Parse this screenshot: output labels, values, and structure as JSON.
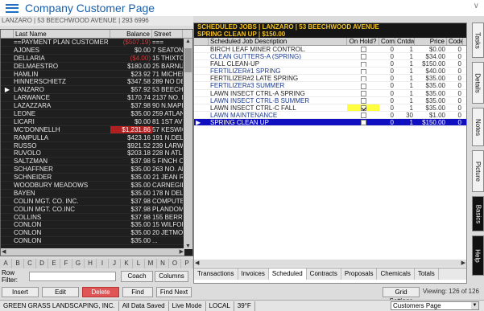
{
  "app": {
    "title": "Company Customer Page",
    "subtitle": "LANZARO | 53 BEECHWOOD AVENUE | 293 6996"
  },
  "customers": {
    "headers": [
      "Last Name",
      "Balance",
      "Street"
    ],
    "rows": [
      {
        "name": "==PAYMENT PLAN CUSTOMER",
        "balance": "($507.19)",
        "street": "===",
        "neg": true
      },
      {
        "name": "AJONES",
        "balance": "$0.00",
        "street": "7 SEATON"
      },
      {
        "name": "DELLARIA",
        "balance": "($4.00)",
        "street": "15 THIXTO",
        "neg": true
      },
      {
        "name": "DELMAESTRO",
        "balance": "$180.00",
        "street": "25 BARNUI"
      },
      {
        "name": "HAMLIN",
        "balance": "$23.92",
        "street": "71 MICHEL"
      },
      {
        "name": "HINNERSCHIETZ",
        "balance": "$347.58",
        "street": "289 NO DE"
      },
      {
        "name": "LANZARO",
        "balance": "$57.92",
        "street": "53 BEECH",
        "current": true
      },
      {
        "name": "LARWANCE",
        "balance": "$170.74",
        "street": "2137 NO. D"
      },
      {
        "name": "LAZAZZARA",
        "balance": "$37.98",
        "street": "90 N.MAPL"
      },
      {
        "name": "LEONE",
        "balance": "$35.00",
        "street": "259 ATLAN"
      },
      {
        "name": "LICARI",
        "balance": "$0.00",
        "street": "81 1ST AVE"
      },
      {
        "name": "MC'DONNELLH",
        "balance": "$1,231.86",
        "street": "57 KESWIC",
        "red": true
      },
      {
        "name": "RAMPULLA",
        "balance": "$423.16",
        "street": "191 N.DEL"
      },
      {
        "name": "RUSSO",
        "balance": "$921.52",
        "street": "239 LARW"
      },
      {
        "name": "RUVOLO",
        "balance": "$203.18",
        "street": "228 N ATL"
      },
      {
        "name": "SALTZMAN",
        "balance": "$37.98",
        "street": "5 FINCH C"
      },
      {
        "name": "SCHAFFNER",
        "balance": "$35.00",
        "street": "263 NO. Al"
      },
      {
        "name": "SCHNEIDER",
        "balance": "$35.00",
        "street": "21 JEAN R"
      },
      {
        "name": "WOODBURY MEADOWS",
        "balance": "$35.00",
        "street": "CARNEGIE"
      },
      {
        "name": "BAYEN",
        "balance": "$35.00",
        "street": "178 N DEL"
      },
      {
        "name": "COLIN MGT. CO. INC.",
        "balance": "$37.98",
        "street": "COMPUTER"
      },
      {
        "name": "COLIN MGT. CO.INC",
        "balance": "$37.98",
        "street": "PLANDOMI"
      },
      {
        "name": "COLLINS",
        "balance": "$37.98",
        "street": "155 BERRY"
      },
      {
        "name": "CONLON",
        "balance": "$35.00",
        "street": "15 WILFOR"
      },
      {
        "name": "CONLON",
        "balance": "$35.00",
        "street": "20 JETMO"
      },
      {
        "name": "CONLON",
        "balance": "$35.00",
        "street": "..."
      }
    ]
  },
  "alphabet": [
    "A",
    "B",
    "C",
    "D",
    "E",
    "F",
    "G",
    "H",
    "I",
    "J",
    "K",
    "L",
    "M",
    "N",
    "O",
    "P"
  ],
  "row_filter": {
    "label": "Row Filter:",
    "value": ""
  },
  "buttons": {
    "coach": "Coach",
    "columns": "Columns",
    "insert": "Insert",
    "edit": "Edit",
    "delete": "Delete",
    "find": "Find",
    "find_next": "Find Next",
    "grid_settings": "Grid Settings"
  },
  "viewing": "Viewing: 126 of 126",
  "status": {
    "company": "GREEN GRASS LANDSCAPING, INC.",
    "saved": "All Data Saved",
    "mode": "Live Mode",
    "local": "LOCAL",
    "temp": "39°F",
    "page_select": "Customers Page"
  },
  "jobs_panel": {
    "header_line1": "SCHEDULED JOBS | LANZARO | 53 BEECHWOOD AVENUE",
    "header_line2": "SPRING CLEAN UP | $150.00",
    "headers": [
      "Scheduled Job Description",
      "On Hold?",
      "Comp",
      "Cntdwn",
      "Price",
      "Code"
    ],
    "rows": [
      {
        "desc": "BIRCH LEAF MINER CONTROL.",
        "hold": false,
        "comp": "0",
        "cnt": "1",
        "price": "$0.00",
        "code": "0"
      },
      {
        "desc": "CLEAN GUTTERS-A (SPRING)",
        "hold": false,
        "comp": "0",
        "cnt": "1",
        "price": "$34.00",
        "code": "0"
      },
      {
        "desc": "FALL CLEAN-UP",
        "hold": false,
        "comp": "0",
        "cnt": "1",
        "price": "$150.00",
        "code": "0"
      },
      {
        "desc": "FERTILIZER#1 SPRING",
        "hold": false,
        "comp": "0",
        "cnt": "1",
        "price": "$40.00",
        "code": "0"
      },
      {
        "desc": "FERTILIZER#2 LATE SPRING",
        "hold": false,
        "comp": "0",
        "cnt": "1",
        "price": "$35.00",
        "code": "0"
      },
      {
        "desc": "FERTILIZER#3 SUMMER",
        "hold": false,
        "comp": "0",
        "cnt": "1",
        "price": "$35.00",
        "code": "0"
      },
      {
        "desc": "LAWN INSECT CTRL-A SPRING",
        "hold": false,
        "comp": "0",
        "cnt": "1",
        "price": "$35.00",
        "code": "0"
      },
      {
        "desc": "LAWN INSECT CTRL-B SUMMER",
        "hold": false,
        "comp": "0",
        "cnt": "1",
        "price": "$35.00",
        "code": "0"
      },
      {
        "desc": "LAWN INSECT CTRL-C FALL",
        "hold": true,
        "comp": "0",
        "cnt": "1",
        "price": "$35.00",
        "code": "0"
      },
      {
        "desc": "LAWN MAINTENANCE",
        "hold": false,
        "comp": "0",
        "cnt": "30",
        "price": "$1.00",
        "code": "0"
      },
      {
        "desc": "SPRING CLEAN UP",
        "hold": false,
        "comp": "0",
        "cnt": "1",
        "price": "$150.00",
        "code": "0",
        "selected": true
      }
    ],
    "tabs": [
      "Transactions",
      "Invoices",
      "Scheduled",
      "Contracts",
      "Proposals",
      "Chemicals",
      "Totals"
    ],
    "active_tab": "Scheduled"
  },
  "side_tabs": [
    "Tasks",
    "Details",
    "Notes",
    "Picture",
    "Basics",
    "Help"
  ]
}
